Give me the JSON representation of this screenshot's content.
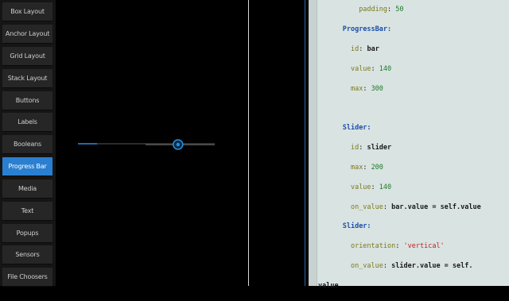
{
  "sidebar": {
    "items": [
      {
        "label": "Box Layout"
      },
      {
        "label": "Anchor Layout"
      },
      {
        "label": "Grid Layout"
      },
      {
        "label": "Stack Layout"
      },
      {
        "label": "Buttons"
      },
      {
        "label": "Labels"
      },
      {
        "label": "Booleans"
      },
      {
        "label": "Progress Bar",
        "active": true
      },
      {
        "label": "Media"
      },
      {
        "label": "Text"
      },
      {
        "label": "Popups"
      },
      {
        "label": "Sensors"
      },
      {
        "label": "File Choosers"
      }
    ]
  },
  "progress_bar": {
    "value": 140,
    "max": 300
  },
  "horizontal_slider": {
    "value": 140,
    "max": 200
  },
  "colors": {
    "accent": "#2a7fd0",
    "editor_bg": "#d9e3e2"
  },
  "code": {
    "l0": {
      "prop": "padding",
      "sep": ": ",
      "val": "50"
    },
    "l1": {
      "kw": "ProgressBar:"
    },
    "l2": {
      "prop": "id",
      "sep": ": ",
      "val": "bar"
    },
    "l3": {
      "prop": "value",
      "sep": ": ",
      "val": "140"
    },
    "l4": {
      "prop": "max",
      "sep": ": ",
      "val": "300"
    },
    "l5": {
      "kw": "Slider:"
    },
    "l6": {
      "prop": "id",
      "sep": ": ",
      "val": "slider"
    },
    "l7": {
      "prop": "max",
      "sep": ": ",
      "val": "200"
    },
    "l8": {
      "prop": "value",
      "sep": ": ",
      "val": "140"
    },
    "l9": {
      "prop": "on_value",
      "sep": ": ",
      "val": "bar.value = self.value"
    },
    "l10": {
      "kw": "Slider:"
    },
    "l11": {
      "prop": "orientation",
      "sep": ": ",
      "val": "'vertical'"
    },
    "l12": {
      "prop": "on_value",
      "sep": ": ",
      "val": "slider.value = self."
    },
    "l13": {
      "val": "value"
    }
  }
}
